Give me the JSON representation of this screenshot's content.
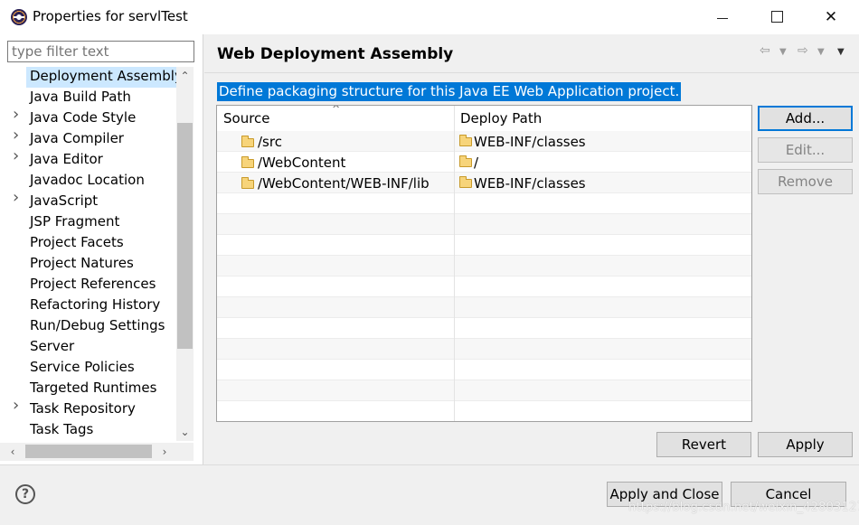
{
  "window": {
    "title": "Properties for servlTest",
    "minimize_label": "",
    "maximize_label": "",
    "close_label": "✕"
  },
  "filter": {
    "placeholder": "type filter text"
  },
  "tree": {
    "items": [
      {
        "label": "Deployment Assembly",
        "expandable": false,
        "selected": true
      },
      {
        "label": "Java Build Path",
        "expandable": false
      },
      {
        "label": "Java Code Style",
        "expandable": true
      },
      {
        "label": "Java Compiler",
        "expandable": true
      },
      {
        "label": "Java Editor",
        "expandable": true
      },
      {
        "label": "Javadoc Location",
        "expandable": false
      },
      {
        "label": "JavaScript",
        "expandable": true
      },
      {
        "label": "JSP Fragment",
        "expandable": false
      },
      {
        "label": "Project Facets",
        "expandable": false
      },
      {
        "label": "Project Natures",
        "expandable": false
      },
      {
        "label": "Project References",
        "expandable": false
      },
      {
        "label": "Refactoring History",
        "expandable": false
      },
      {
        "label": "Run/Debug Settings",
        "expandable": false
      },
      {
        "label": "Server",
        "expandable": false
      },
      {
        "label": "Service Policies",
        "expandable": false
      },
      {
        "label": "Targeted Runtimes",
        "expandable": false
      },
      {
        "label": "Task Repository",
        "expandable": true
      },
      {
        "label": "Task Tags",
        "expandable": false
      }
    ]
  },
  "page": {
    "title": "Web Deployment Assembly",
    "description": "Define packaging structure for this Java EE Web Application project."
  },
  "table": {
    "columns": [
      "Source",
      "Deploy Path"
    ],
    "rows": [
      {
        "source": "/src",
        "deploy_path": "WEB-INF/classes"
      },
      {
        "source": "/WebContent",
        "deploy_path": "/"
      },
      {
        "source": "/WebContent/WEB-INF/lib",
        "deploy_path": "WEB-INF/classes"
      }
    ]
  },
  "buttons": {
    "add": "Add...",
    "edit": "Edit...",
    "remove": "Remove",
    "revert": "Revert",
    "apply": "Apply",
    "apply_and_close": "Apply and Close",
    "cancel": "Cancel",
    "help": "?"
  },
  "watermark": "https://blog.csdn.net/weixin_42803127",
  "colors": {
    "selection": "#0078d7",
    "tree_selection": "#cce8ff"
  }
}
